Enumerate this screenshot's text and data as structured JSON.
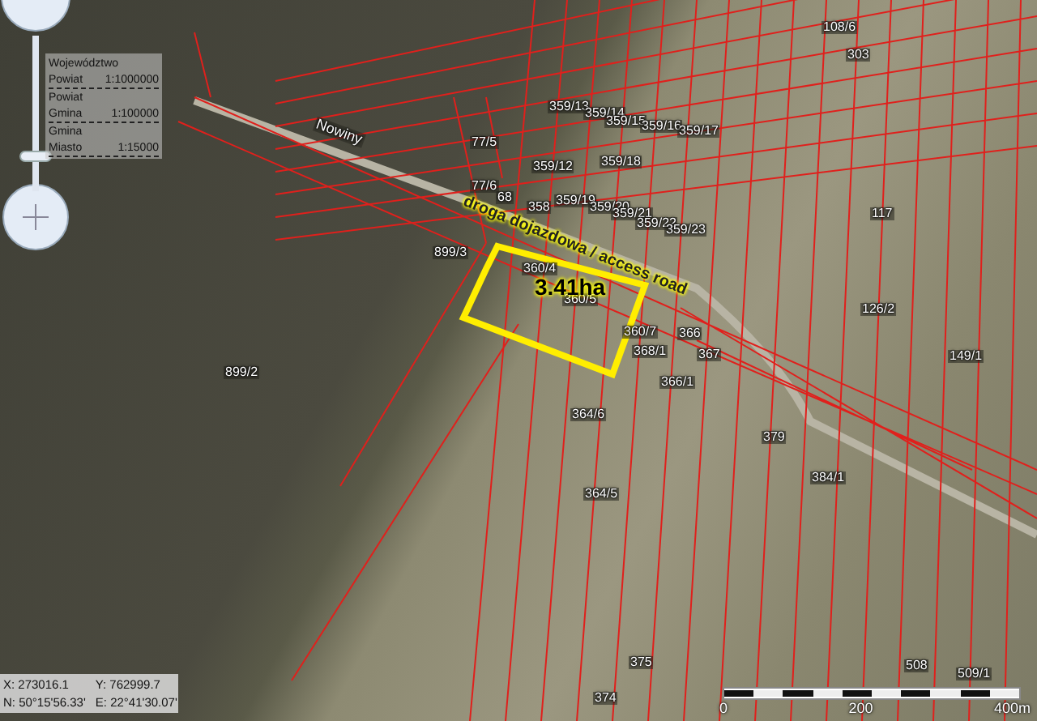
{
  "map": {
    "place_name": "Nowiny",
    "road_label": "droga dojazdowa / access road",
    "area_label": "3.41ha",
    "parcels": [
      "108/6",
      "303",
      "359/13",
      "359/14",
      "359/15",
      "359/16",
      "359/17",
      "77/5",
      "359/12",
      "359/18",
      "77/6",
      "68",
      "358",
      "359/19",
      "359/20",
      "359/21",
      "359/22",
      "359/23",
      "117",
      "899/3",
      "360/4",
      "360/5",
      "126/2",
      "360/7",
      "366",
      "368/1",
      "367",
      "149/1",
      "899/2",
      "366/1",
      "364/6",
      "379",
      "384/1",
      "364/5",
      "375",
      "508",
      "509/1",
      "374"
    ]
  },
  "zoom_slider": {
    "level": 0.2
  },
  "scale_legend": [
    {
      "label": "Województwo"
    },
    {
      "label": "Powiat",
      "scale": "1:1000000"
    },
    {
      "label": "Powiat"
    },
    {
      "label": "Gmina",
      "scale": "1:100000"
    },
    {
      "label": "Gmina"
    },
    {
      "label": "Miasto",
      "scale": "1:15000"
    }
  ],
  "coordinates": {
    "x": "X: 273016.1",
    "y": "Y: 762999.7",
    "n": "N: 50°15'56.33'",
    "e": "E: 22°41'30.07'"
  },
  "scale_bar": {
    "labels": [
      "0",
      "200",
      "400m"
    ]
  }
}
